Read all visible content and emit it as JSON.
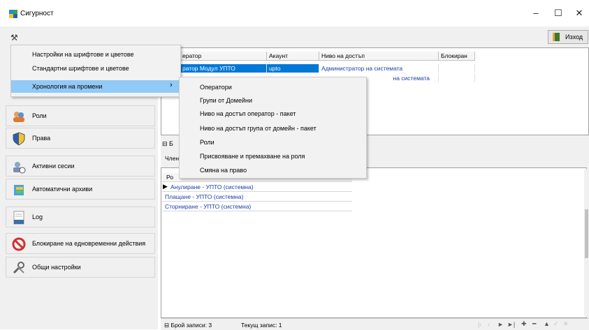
{
  "background_chars": [
    "и",
    "л",
    "я",
    "и",
    ",",
    "е",
    "а",
    "я"
  ],
  "window": {
    "title": "Сигурност",
    "minimize": "–",
    "maximize": "☐",
    "close": "✕"
  },
  "toolbar": {
    "exit_label": "Изход"
  },
  "menu": {
    "items": [
      "Настройки на шрифтове и цветове",
      "Стандартни шрифтове и цветове",
      "Хронология на промени"
    ],
    "submenu_arrow": "›"
  },
  "submenu": {
    "items": [
      "Оператори",
      "Групи от Домейни",
      "Ниво на достъп оператор - пакет",
      "Ниво на достъп група от домейн - пакет",
      "Роли",
      "Присвояване и премахване на роля",
      "Смяна на право"
    ]
  },
  "nav": {
    "items": [
      "Роли",
      "Права",
      "Активни сесии",
      "Автоматични архиви",
      "Log",
      "Блокиране на едновременни действия",
      "Общи настройки"
    ]
  },
  "grid": {
    "headers": [
      "ератор",
      "Акаунт",
      "Ниво на достъп",
      "Блокиран"
    ],
    "rows": [
      [
        "ратор Модул УПТО",
        "upto",
        "Администратор на системата",
        ""
      ],
      [
        "",
        "",
        "на системата",
        ""
      ]
    ]
  },
  "lower": {
    "split_label": "Б",
    "tab_label": "Член",
    "column_header": "Ро",
    "rows": [
      "Анулиране - УПТО (системна)",
      "Плащане - УПТО (системна)",
      "Сторниране - УПТО (системна)"
    ]
  },
  "status": {
    "record_count": "Брой записи: 3",
    "current_record": "Текущ запис: 1"
  },
  "colors": {
    "selection": "#0078d7",
    "menu_highlight": "#91c9f7",
    "link_text": "#1a3fa6"
  }
}
